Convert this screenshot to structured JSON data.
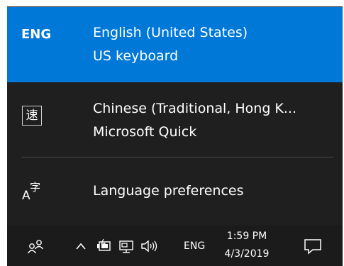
{
  "language_flyout": {
    "items": [
      {
        "code": "ENG",
        "name": "English (United States)",
        "keyboard": "US keyboard",
        "selected": true
      },
      {
        "glyph": "速",
        "name": "Chinese (Traditional, Hong K...",
        "keyboard": "Microsoft Quick",
        "selected": false
      }
    ],
    "preferences_label": "Language preferences",
    "preferences_icon": "language-preferences-icon"
  },
  "taskbar": {
    "language_indicator": "ENG",
    "time": "1:59 PM",
    "date": "4/3/2019",
    "icons": [
      "people-icon",
      "chevron-up-icon",
      "battery-icon",
      "network-icon",
      "speaker-icon",
      "action-center-icon"
    ]
  },
  "colors": {
    "accent": "#0078d7",
    "flyout_background": "#1f1f1f",
    "taskbar_background": "#1b1b1b"
  }
}
